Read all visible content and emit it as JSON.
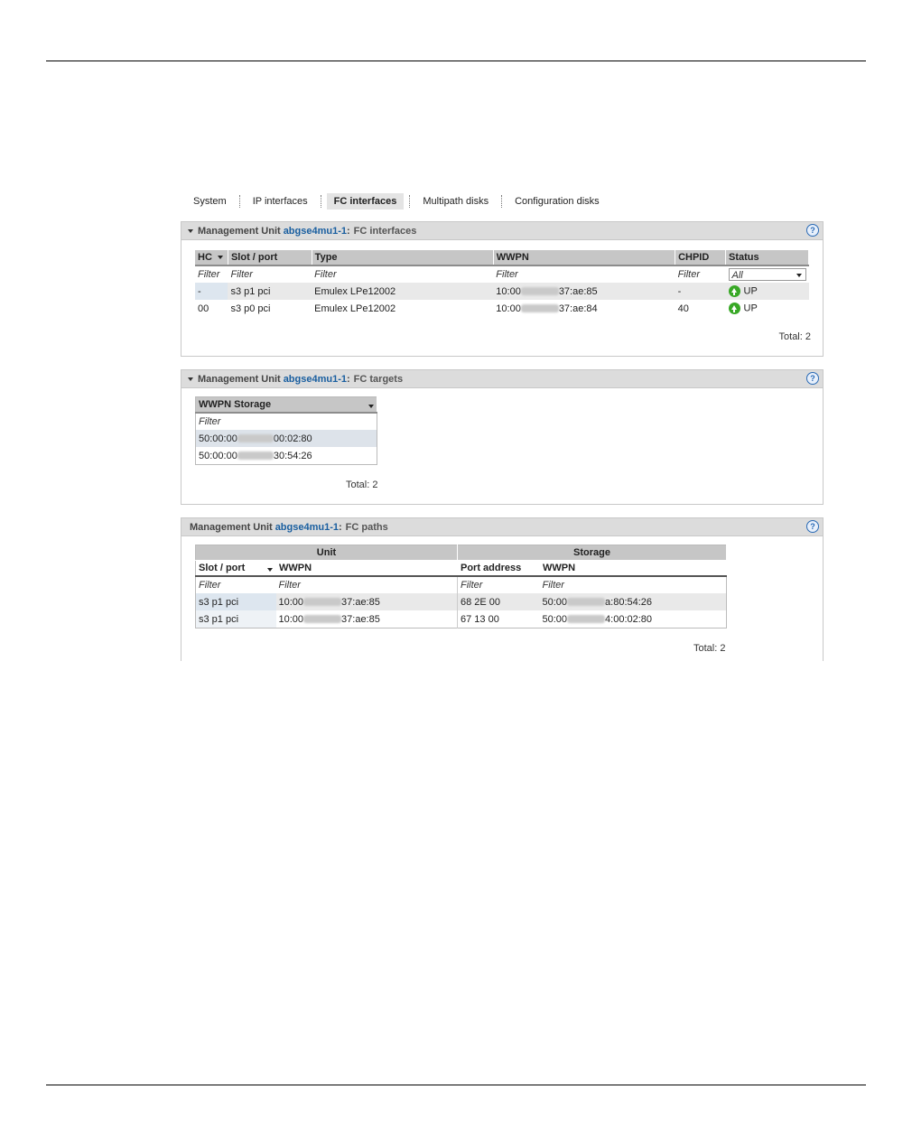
{
  "tabs": [
    "System",
    "IP interfaces",
    "FC interfaces",
    "Multipath disks",
    "Configuration disks"
  ],
  "active_tab": "FC interfaces",
  "panel_label": "Management Unit",
  "unit_name": "abgse4mu1-1",
  "fc_interfaces": {
    "title": "FC interfaces",
    "headers": [
      "HC",
      "Slot / port",
      "Type",
      "WWPN",
      "CHPID",
      "Status"
    ],
    "filters": [
      "Filter",
      "Filter",
      "Filter",
      "Filter",
      "Filter"
    ],
    "status_filter": "All",
    "rows": [
      {
        "hc": "-",
        "slot": "s3 p1 pci",
        "type": "Emulex LPe12002",
        "wwpn_a": "10:00",
        "wwpn_b": "37:ae:85",
        "chpid": "-",
        "status": "UP"
      },
      {
        "hc": "00",
        "slot": "s3 p0 pci",
        "type": "Emulex LPe12002",
        "wwpn_a": "10:00",
        "wwpn_b": "37:ae:84",
        "chpid": "40",
        "status": "UP"
      }
    ],
    "total_label": "Total:",
    "total": "2"
  },
  "fc_targets": {
    "title": "FC targets",
    "header": "WWPN Storage",
    "filter": "Filter",
    "rows": [
      {
        "a": "50:00:00",
        "b": "00:02:80"
      },
      {
        "a": "50:00:00",
        "b": "30:54:26"
      }
    ],
    "total_label": "Total:",
    "total": "2"
  },
  "fc_paths": {
    "title": "FC paths",
    "group_headers": [
      "Unit",
      "Storage"
    ],
    "headers": [
      "Slot / port",
      "WWPN",
      "Port address",
      "WWPN"
    ],
    "filters": [
      "Filter",
      "Filter",
      "Filter",
      "Filter"
    ],
    "rows": [
      {
        "slot": "s3 p1 pci",
        "wwpn_a": "10:00",
        "wwpn_b": "37:ae:85",
        "port": "68 2E 00",
        "s_a": "50:00",
        "s_b": "a:80:54:26"
      },
      {
        "slot": "s3 p1 pci",
        "wwpn_a": "10:00",
        "wwpn_b": "37:ae:85",
        "port": "67 13 00",
        "s_a": "50:00",
        "s_b": "4:00:02:80"
      }
    ],
    "total_label": "Total:",
    "total": "2"
  }
}
